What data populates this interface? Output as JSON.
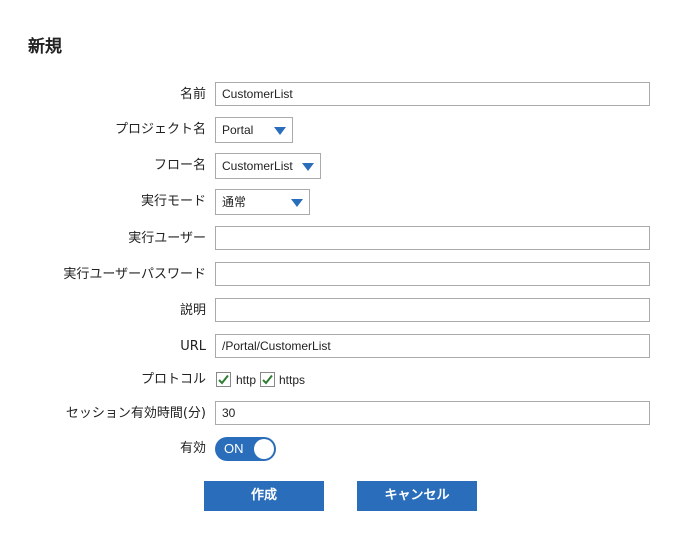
{
  "page": {
    "title": "新規"
  },
  "form": {
    "name": {
      "label": "名前",
      "value": "CustomerList"
    },
    "project": {
      "label": "プロジェクト名",
      "value": "Portal"
    },
    "flow": {
      "label": "フロー名",
      "value": "CustomerList"
    },
    "exec_mode": {
      "label": "実行モード",
      "value": "通常"
    },
    "exec_user": {
      "label": "実行ユーザー",
      "value": ""
    },
    "exec_password": {
      "label": "実行ユーザーパスワード",
      "value": ""
    },
    "description": {
      "label": "説明",
      "value": ""
    },
    "url": {
      "label": "URL",
      "value": "/Portal/CustomerList"
    },
    "protocol": {
      "label": "プロトコル",
      "options": [
        {
          "label": "http",
          "checked": true
        },
        {
          "label": "https",
          "checked": true
        }
      ]
    },
    "session_timeout": {
      "label": "セッション有効時間(分)",
      "value": "30"
    },
    "enabled": {
      "label": "有効",
      "state": "ON"
    }
  },
  "buttons": {
    "create": "作成",
    "cancel": "キャンセル"
  },
  "colors": {
    "accent": "#2a6ebb"
  }
}
